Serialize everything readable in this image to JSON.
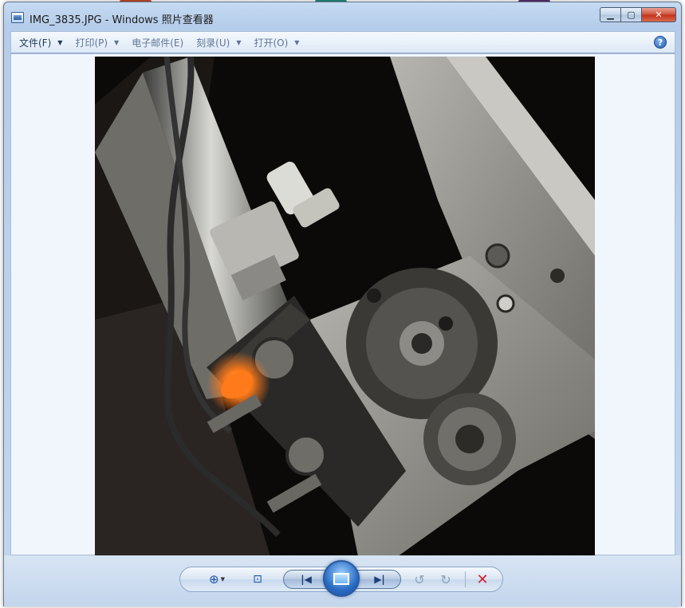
{
  "window": {
    "title": "IMG_3835.JPG - Windows 照片查看器",
    "minimize_glyph": "▁",
    "maximize_glyph": "▢",
    "close_glyph": "✕"
  },
  "menu": {
    "items": [
      {
        "label": "文件(F)",
        "enabled": true
      },
      {
        "label": "打印(P)",
        "enabled": false
      },
      {
        "label": "电子邮件(E)",
        "enabled": false
      },
      {
        "label": "刻录(U)",
        "enabled": false
      },
      {
        "label": "打开(O)",
        "enabled": false
      }
    ],
    "dropdown_glyph": "▼",
    "help_glyph": "?"
  },
  "toolbar": {
    "zoom_icon": "magnifier-plus-icon",
    "zoom_glyph": "⊕",
    "zoom_caret": "▼",
    "fit_icon": "actual-size-icon",
    "fit_glyph": "⊡",
    "prev_icon": "previous-icon",
    "prev_glyph": "|◀",
    "slideshow_icon": "slideshow-icon",
    "next_icon": "next-icon",
    "next_glyph": "▶|",
    "rotate_left_glyph": "↺",
    "rotate_right_glyph": "↻",
    "delete_glyph": "✕"
  },
  "photo": {
    "subject": "machine-assembly-photo",
    "colors": {
      "background": "#0b0a08",
      "sensor_light": "#ff7a1a",
      "metal": "#9b9a94"
    }
  }
}
